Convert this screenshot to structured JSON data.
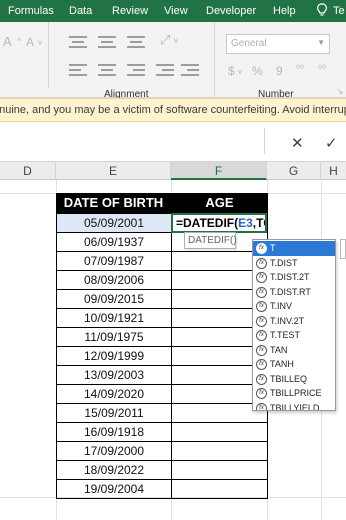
{
  "menubar": {
    "items": [
      "Formulas",
      "Data",
      "Review",
      "View",
      "Developer",
      "Help",
      "Te"
    ],
    "bg_color": "#217346"
  },
  "ribbon": {
    "alignment_label": "Alignment",
    "number_label": "Number",
    "number_format": "General",
    "percent_glyph": "%",
    "comma_glyph": "9",
    "decrease_font": "A",
    "increase_font": "A"
  },
  "warning": {
    "text": "enuine, and you may be a victim of software counterfeiting. Avoid interruption a"
  },
  "formula_bar": {
    "cancel_glyph": "✕",
    "enter_glyph": "✓"
  },
  "columns": [
    "D",
    "E",
    "F",
    "G",
    "H"
  ],
  "table": {
    "headers": [
      "DATE OF BIRTH",
      "AGE"
    ],
    "dates": [
      "05/09/2001",
      "06/09/1937",
      "07/09/1987",
      "08/09/2006",
      "09/09/2015",
      "10/09/1921",
      "11/09/1975",
      "12/09/1999",
      "13/09/2003",
      "14/09/2020",
      "15/09/2011",
      "16/09/1918",
      "17/09/2000",
      "18/09/2022",
      "19/09/2004"
    ]
  },
  "formula": {
    "prefix": "=DATEDIF(",
    "ref": "E3",
    "suffix": ",TO"
  },
  "tooltip": {
    "text": "DATEDIF()"
  },
  "autocomplete": {
    "items": [
      "T",
      "T.DIST",
      "T.DIST.2T",
      "T.DIST.RT",
      "T.INV",
      "T.INV.2T",
      "T.TEST",
      "TAN",
      "TANH",
      "TBILLEQ",
      "TBILLPRICE",
      "TBILLYIELD"
    ],
    "active_index": 0,
    "icon_glyph": "fx",
    "highlight_color": "#2b78d6"
  }
}
